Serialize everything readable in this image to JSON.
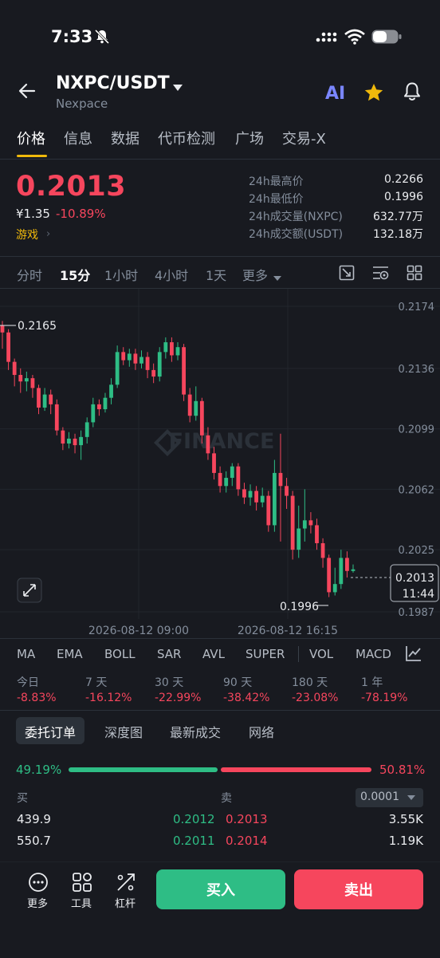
{
  "status_bar": {
    "time": "7:33"
  },
  "header": {
    "pair": "NXPC/USDT",
    "name": "Nexpace",
    "ai_label": "AI"
  },
  "tabs": [
    "价格",
    "信息",
    "数据",
    "代币检测",
    "广场",
    "交易-X"
  ],
  "price": {
    "last": "0.2013",
    "cny": "¥1.35",
    "change": "-10.89%",
    "tag": "游戏",
    "stats": [
      {
        "label": "24h最高价",
        "value": "0.2266"
      },
      {
        "label": "24h最低价",
        "value": "0.1996"
      },
      {
        "label": "24h成交量(NXPC)",
        "value": "632.77万"
      },
      {
        "label": "24h成交额(USDT)",
        "value": "132.18万"
      }
    ]
  },
  "intervals": [
    "分时",
    "15分",
    "1小时",
    "4小时",
    "1天",
    "更多"
  ],
  "chart": {
    "watermark": "FINANCE",
    "high_label": "0.2165",
    "low_label": "0.1996",
    "current_price": "0.2013",
    "countdown": "11:44",
    "time_labels": [
      "2026-08-12 09:00",
      "2026-08-12 16:15"
    ]
  },
  "chart_data": {
    "type": "candlestick",
    "y_ticks": [
      "0.2174",
      "0.2136",
      "0.2099",
      "0.2062",
      "0.2025",
      "0.1987"
    ],
    "ylim": [
      0.1987,
      0.2174
    ],
    "candles": [
      [
        0.2162,
        0.2158,
        0.2165,
        0.2148
      ],
      [
        0.2158,
        0.214,
        0.216,
        0.2135
      ],
      [
        0.214,
        0.2132,
        0.2142,
        0.2125
      ],
      [
        0.2132,
        0.2128,
        0.2136,
        0.2121
      ],
      [
        0.2128,
        0.213,
        0.2134,
        0.2122
      ],
      [
        0.213,
        0.2124,
        0.2132,
        0.2118
      ],
      [
        0.2124,
        0.2112,
        0.2126,
        0.2108
      ],
      [
        0.2112,
        0.212,
        0.2124,
        0.211
      ],
      [
        0.212,
        0.2114,
        0.2123,
        0.2108
      ],
      [
        0.2114,
        0.2098,
        0.2117,
        0.2095
      ],
      [
        0.2098,
        0.209,
        0.21,
        0.2086
      ],
      [
        0.209,
        0.2093,
        0.2097,
        0.2087
      ],
      [
        0.2093,
        0.2089,
        0.2096,
        0.2084
      ],
      [
        0.2089,
        0.2094,
        0.2098,
        0.208
      ],
      [
        0.2094,
        0.2103,
        0.2106,
        0.209
      ],
      [
        0.2103,
        0.2114,
        0.2118,
        0.21
      ],
      [
        0.2114,
        0.2111,
        0.2117,
        0.2107
      ],
      [
        0.2111,
        0.2118,
        0.2121,
        0.2109
      ],
      [
        0.2118,
        0.2126,
        0.213,
        0.2114
      ],
      [
        0.2126,
        0.2146,
        0.215,
        0.2124
      ],
      [
        0.2146,
        0.2141,
        0.2149,
        0.2138
      ],
      [
        0.2141,
        0.2145,
        0.2148,
        0.2137
      ],
      [
        0.2145,
        0.2139,
        0.2148,
        0.2135
      ],
      [
        0.2139,
        0.2143,
        0.2147,
        0.2136
      ],
      [
        0.2143,
        0.2135,
        0.2146,
        0.213
      ],
      [
        0.2135,
        0.2131,
        0.2139,
        0.2127
      ],
      [
        0.2131,
        0.2146,
        0.2149,
        0.2128
      ],
      [
        0.2146,
        0.2152,
        0.2155,
        0.2142
      ],
      [
        0.2152,
        0.2144,
        0.2155,
        0.214
      ],
      [
        0.2144,
        0.2149,
        0.2152,
        0.2141
      ],
      [
        0.2149,
        0.212,
        0.2151,
        0.2116
      ],
      [
        0.212,
        0.2107,
        0.2124,
        0.2103
      ],
      [
        0.2107,
        0.2116,
        0.2125,
        0.2104
      ],
      [
        0.2116,
        0.2095,
        0.2118,
        0.209
      ],
      [
        0.2095,
        0.2084,
        0.21,
        0.208
      ],
      [
        0.2084,
        0.2072,
        0.2088,
        0.2068
      ],
      [
        0.2072,
        0.2064,
        0.2076,
        0.206
      ],
      [
        0.2064,
        0.2069,
        0.2073,
        0.206
      ],
      [
        0.2069,
        0.2076,
        0.2078,
        0.2064
      ],
      [
        0.2076,
        0.2062,
        0.2078,
        0.2058
      ],
      [
        0.2062,
        0.2057,
        0.2066,
        0.2053
      ],
      [
        0.2057,
        0.2061,
        0.2065,
        0.2052
      ],
      [
        0.2061,
        0.2054,
        0.2064,
        0.2049
      ],
      [
        0.2054,
        0.2058,
        0.2063,
        0.2051
      ],
      [
        0.2058,
        0.204,
        0.2061,
        0.2036
      ],
      [
        0.204,
        0.2072,
        0.208,
        0.2036
      ],
      [
        0.2072,
        0.2064,
        0.2096,
        0.203
      ],
      [
        0.2064,
        0.2058,
        0.2069,
        0.205
      ],
      [
        0.2058,
        0.2025,
        0.2061,
        0.2019
      ],
      [
        0.2025,
        0.2038,
        0.2052,
        0.202
      ],
      [
        0.2038,
        0.2043,
        0.2062,
        0.203
      ],
      [
        0.2043,
        0.204,
        0.2048,
        0.2035
      ],
      [
        0.204,
        0.2029,
        0.2044,
        0.2025
      ],
      [
        0.2029,
        0.202,
        0.2032,
        0.2014
      ],
      [
        0.202,
        0.1999,
        0.2022,
        0.1996
      ],
      [
        0.1999,
        0.2004,
        0.2014,
        0.1997
      ],
      [
        0.2004,
        0.202,
        0.2025,
        0.2001
      ],
      [
        0.202,
        0.2012,
        0.2024,
        0.2008
      ],
      [
        0.2012,
        0.2013,
        0.2016,
        0.2011
      ]
    ]
  },
  "indicators": [
    "MA",
    "EMA",
    "BOLL",
    "SAR",
    "AVL",
    "SUPER",
    "VOL",
    "MACD"
  ],
  "performance": [
    {
      "label": "今日",
      "value": "-8.83%"
    },
    {
      "label": "7 天",
      "value": "-16.12%"
    },
    {
      "label": "30 天",
      "value": "-22.99%"
    },
    {
      "label": "90 天",
      "value": "-38.42%"
    },
    {
      "label": "180 天",
      "value": "-23.08%"
    },
    {
      "label": "1 年",
      "value": "-78.19%"
    }
  ],
  "orderbook": {
    "tabs": [
      "委托订单",
      "深度图",
      "最新成交",
      "网络"
    ],
    "buy_ratio": "49.19%",
    "sell_ratio": "50.81%",
    "buy_fraction": 0.4919,
    "buy_col": "买",
    "sell_col": "卖",
    "precision": "0.0001",
    "rows": [
      {
        "bid_qty": "439.9",
        "bid_price": "0.2012",
        "ask_price": "0.2013",
        "ask_qty": "3.55K"
      },
      {
        "bid_qty": "550.7",
        "bid_price": "0.2011",
        "ask_price": "0.2014",
        "ask_qty": "1.19K"
      }
    ]
  },
  "bottom": {
    "more": "更多",
    "tools": "工具",
    "leverage": "杠杆",
    "buy": "买入",
    "sell": "卖出"
  },
  "colors": {
    "up": "#2ebd85",
    "down": "#f6465d",
    "accent": "#f0b90b",
    "bg": "#181a20"
  }
}
